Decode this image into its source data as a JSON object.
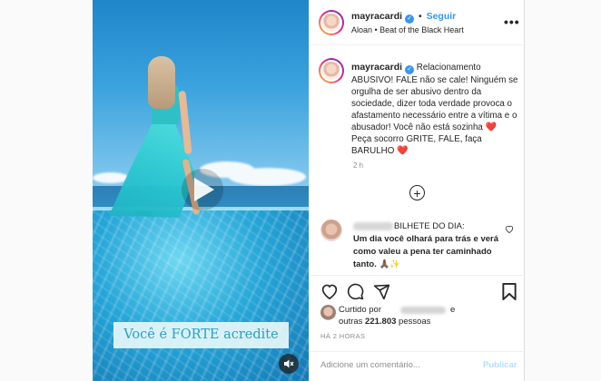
{
  "header": {
    "username": "mayracardi",
    "follow_label": "Seguir",
    "separator": "•",
    "audio": "Aloan • Beat of the Black Heart",
    "more_icon": "more-horizontal-icon"
  },
  "media": {
    "caption_overlay": "Você é FORTE acredite",
    "play_icon": "play-icon",
    "mute_icon": "speaker-muted-icon"
  },
  "post_caption": {
    "username": "mayracardi",
    "text_1": "Relacionamento ABUSIVO! FALE não se cale! Ninguém se orgulha de ser abusivo dentro da sociedade, dizer toda verdade provoca o afastamento necessário entre a vítima e o abusador! Você não está sozinha",
    "heart_1": "❤️",
    "text_2": "Peça socorro GRITE, FALE, faça BARULHO",
    "heart_2": "❤️",
    "time": "2 h"
  },
  "comment": {
    "header_text": "BILHETE DO DIA:",
    "body": "Um dia você olhará para trás e verá como valeu a pena ter caminhado tanto. 🙏🏾✨"
  },
  "likes": {
    "prefix": "Curtido por",
    "conjunction": "e",
    "others_prefix": "outras",
    "count": "221.803",
    "suffix": "pessoas"
  },
  "timestamp": "HÁ 2 HORAS",
  "add_comment": {
    "placeholder": "Adicione um comentário...",
    "publish_label": "Publicar"
  },
  "colors": {
    "accent": "#3897f0",
    "publish_disabled": "#b2dffc",
    "heart": "#ed4956",
    "text": "#262626",
    "muted": "#8e8e8e"
  }
}
